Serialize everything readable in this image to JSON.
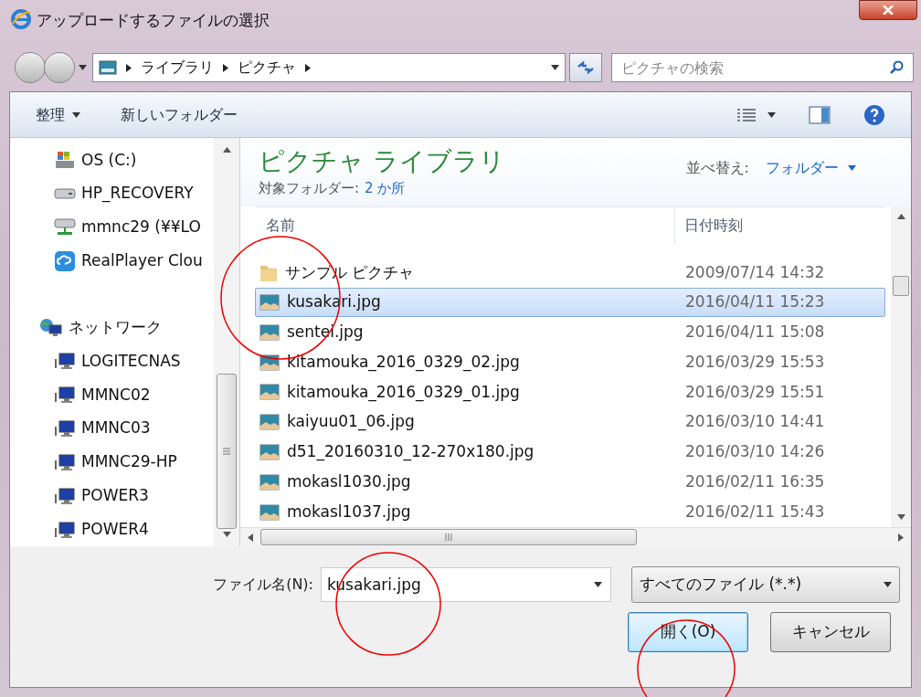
{
  "window": {
    "title": "アップロードするファイルの選択"
  },
  "address": {
    "breadcrumb": [
      "ライブラリ",
      "ピクチャ"
    ]
  },
  "search": {
    "placeholder": "ピクチャの検索"
  },
  "toolbar": {
    "buttons": [
      {
        "label": "整理",
        "menu": true
      },
      {
        "label": "新しいフォルダー",
        "menu": false
      }
    ]
  },
  "sidebar": {
    "items": [
      {
        "kind": "drive",
        "label": "OS (C:)"
      },
      {
        "kind": "disk",
        "label": "HP_RECOVERY"
      },
      {
        "kind": "netdrive",
        "label": "mmnc29 (¥¥LO"
      },
      {
        "kind": "cloud",
        "label": "RealPlayer Clou"
      },
      {
        "kind": "network",
        "label": "ネットワーク"
      },
      {
        "kind": "computer",
        "label": "LOGITECNAS"
      },
      {
        "kind": "computer",
        "label": "MMNC02"
      },
      {
        "kind": "computer",
        "label": "MMNC03"
      },
      {
        "kind": "computer",
        "label": "MMNC29-HP"
      },
      {
        "kind": "computer",
        "label": "POWER3"
      },
      {
        "kind": "computer",
        "label": "POWER4"
      }
    ]
  },
  "library": {
    "title": "ピクチャ ライブラリ",
    "subtitle_label": "対象フォルダー:",
    "subtitle_link": "2 か所",
    "sort_label": "並べ替え:",
    "sort_value": "フォルダー"
  },
  "table": {
    "columns": [
      "名前",
      "日付時刻"
    ],
    "rows": [
      {
        "kind": "folder",
        "name": "サンプル ピクチャ",
        "date": "2009/07/14 14:32",
        "selected": false
      },
      {
        "kind": "image",
        "name": "kusakari.jpg",
        "date": "2016/04/11 15:23",
        "selected": true
      },
      {
        "kind": "image",
        "name": "sentei.jpg",
        "date": "2016/04/11 15:08",
        "selected": false
      },
      {
        "kind": "image",
        "name": "kitamouka_2016_0329_02.jpg",
        "date": "2016/03/29 15:53",
        "selected": false
      },
      {
        "kind": "image",
        "name": "kitamouka_2016_0329_01.jpg",
        "date": "2016/03/29 15:51",
        "selected": false
      },
      {
        "kind": "image",
        "name": "kaiyuu01_06.jpg",
        "date": "2016/03/10 14:41",
        "selected": false
      },
      {
        "kind": "image",
        "name": "d51_20160310_12-270x180.jpg",
        "date": "2016/03/10 14:26",
        "selected": false
      },
      {
        "kind": "image",
        "name": "mokasl1030.jpg",
        "date": "2016/02/11 16:35",
        "selected": false
      },
      {
        "kind": "image",
        "name": "mokasl1037.jpg",
        "date": "2016/02/11 15:43",
        "selected": false
      }
    ]
  },
  "footer": {
    "filename_label": "ファイル名(N):",
    "filename_value": "kusakari.jpg",
    "filetype": "すべてのファイル (*.*)",
    "buttons": [
      {
        "label": "開く(O)",
        "default": true
      },
      {
        "label": "キャンセル",
        "default": false
      }
    ]
  }
}
